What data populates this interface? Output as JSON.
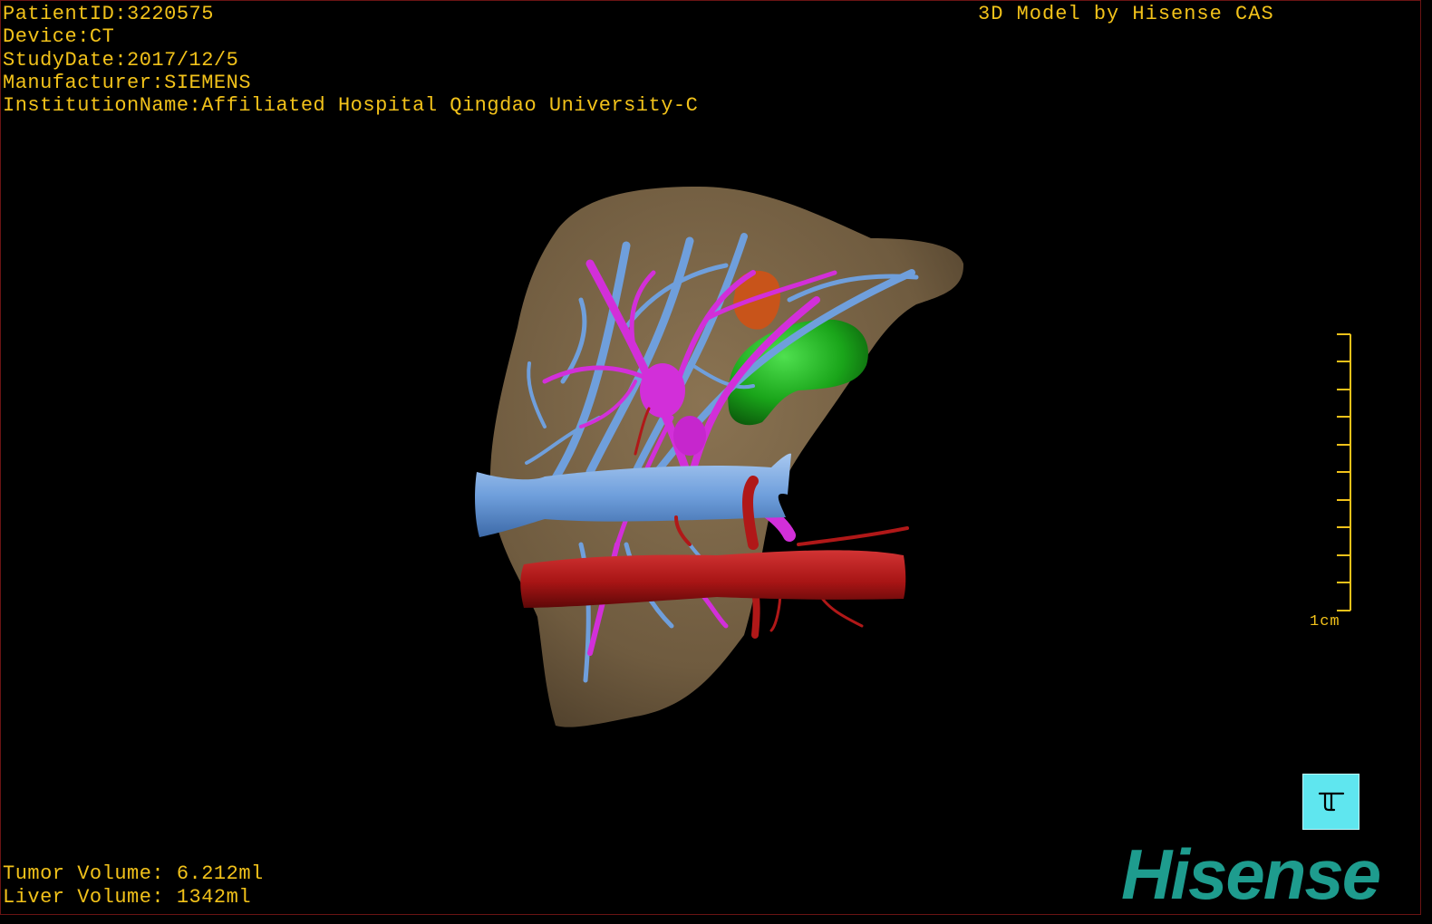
{
  "study": {
    "patient_id": "PatientID:3220575",
    "device": "Device:CT",
    "study_date": "StudyDate:2017/12/5",
    "manufacturer": "Manufacturer:SIEMENS",
    "institution": "InstitutionName:Affiliated Hospital Qingdao University-C"
  },
  "credit": "3D Model by Hisense CAS",
  "volumes": {
    "tumor": "Tumor Volume: 6.212ml",
    "liver": "Liver Volume: 1342ml"
  },
  "scale_bar": {
    "label": "1cm",
    "ticks": 10
  },
  "orientation_cube": {
    "icon": "orientation-cube-icon",
    "color": "#5fe6ef"
  },
  "brand": {
    "name": "Hisense",
    "color": "#1e9c8e"
  },
  "colors": {
    "overlay_text": "#f2c21a",
    "liver": "#7a6447",
    "portal_vein": "#6f9fdc",
    "hepatic_vein": "#d22fd9",
    "artery": "#b01818",
    "tumor": "#1fb21f",
    "gallbladder": "#c8541a"
  }
}
